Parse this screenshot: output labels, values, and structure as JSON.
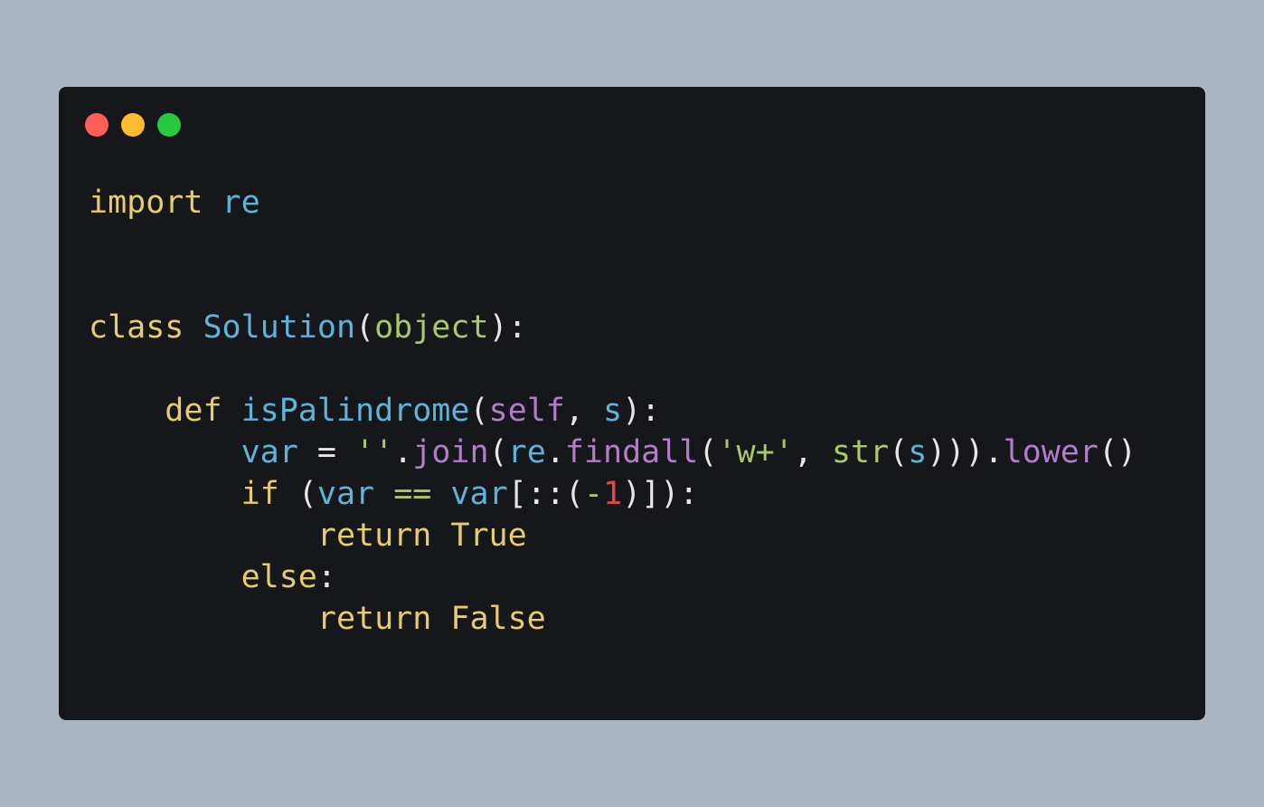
{
  "window": {
    "traffic_lights": {
      "close_color": "#ff5f57",
      "minimize_color": "#febc2e",
      "maximize_color": "#28c840"
    }
  },
  "code": {
    "language": "python",
    "lines": [
      {
        "tokens": [
          {
            "text": "import",
            "type": "keyword"
          },
          {
            "text": " ",
            "type": "plain"
          },
          {
            "text": "re",
            "type": "name"
          }
        ]
      },
      {
        "tokens": [
          {
            "text": "class",
            "type": "keyword"
          },
          {
            "text": " ",
            "type": "plain"
          },
          {
            "text": "Solution",
            "type": "name"
          },
          {
            "text": "(",
            "type": "plain"
          },
          {
            "text": "object",
            "type": "builtin"
          },
          {
            "text": "):",
            "type": "plain"
          }
        ]
      },
      {
        "tokens": [
          {
            "text": "    ",
            "type": "plain"
          },
          {
            "text": "def",
            "type": "keyword"
          },
          {
            "text": " ",
            "type": "plain"
          },
          {
            "text": "isPalindrome",
            "type": "name"
          },
          {
            "text": "(",
            "type": "plain"
          },
          {
            "text": "self",
            "type": "self"
          },
          {
            "text": ", ",
            "type": "plain"
          },
          {
            "text": "s",
            "type": "name"
          },
          {
            "text": "):",
            "type": "plain"
          }
        ]
      },
      {
        "tokens": [
          {
            "text": "        ",
            "type": "plain"
          },
          {
            "text": "var",
            "type": "name"
          },
          {
            "text": " = ",
            "type": "plain"
          },
          {
            "text": "''",
            "type": "string"
          },
          {
            "text": ".",
            "type": "plain"
          },
          {
            "text": "join",
            "type": "method"
          },
          {
            "text": "(",
            "type": "plain"
          },
          {
            "text": "re",
            "type": "name"
          },
          {
            "text": ".",
            "type": "plain"
          },
          {
            "text": "findall",
            "type": "method"
          },
          {
            "text": "(",
            "type": "plain"
          },
          {
            "text": "'w+'",
            "type": "string"
          },
          {
            "text": ", ",
            "type": "plain"
          },
          {
            "text": "str",
            "type": "builtin"
          },
          {
            "text": "(",
            "type": "plain"
          },
          {
            "text": "s",
            "type": "name"
          },
          {
            "text": "))).",
            "type": "plain"
          },
          {
            "text": "lower",
            "type": "method"
          },
          {
            "text": "()",
            "type": "plain"
          }
        ]
      },
      {
        "tokens": [
          {
            "text": "        ",
            "type": "plain"
          },
          {
            "text": "if",
            "type": "keyword"
          },
          {
            "text": " (",
            "type": "plain"
          },
          {
            "text": "var",
            "type": "name"
          },
          {
            "text": " ",
            "type": "plain"
          },
          {
            "text": "==",
            "type": "operator"
          },
          {
            "text": " ",
            "type": "plain"
          },
          {
            "text": "var",
            "type": "name"
          },
          {
            "text": "[::(",
            "type": "plain"
          },
          {
            "text": "-",
            "type": "operator"
          },
          {
            "text": "1",
            "type": "number"
          },
          {
            "text": ")]):",
            "type": "plain"
          }
        ]
      },
      {
        "tokens": [
          {
            "text": "            ",
            "type": "plain"
          },
          {
            "text": "return",
            "type": "keyword"
          },
          {
            "text": " ",
            "type": "plain"
          },
          {
            "text": "True",
            "type": "keyword"
          }
        ]
      },
      {
        "tokens": [
          {
            "text": "        ",
            "type": "plain"
          },
          {
            "text": "else",
            "type": "keyword"
          },
          {
            "text": ":",
            "type": "plain"
          }
        ]
      },
      {
        "tokens": [
          {
            "text": "            ",
            "type": "plain"
          },
          {
            "text": "return",
            "type": "keyword"
          },
          {
            "text": " ",
            "type": "plain"
          },
          {
            "text": "False",
            "type": "keyword"
          }
        ]
      }
    ]
  },
  "colors": {
    "background": "#abb5bf",
    "window": "#16171a",
    "keyword": "#e5cc6f",
    "name": "#5fb3d9",
    "builtin": "#a8c86a",
    "method": "#b07ec9",
    "self": "#b07ec9",
    "string": "#a8c86a",
    "operator": "#a8c86a",
    "number": "#e0474c",
    "plain": "#e6e6e6"
  }
}
